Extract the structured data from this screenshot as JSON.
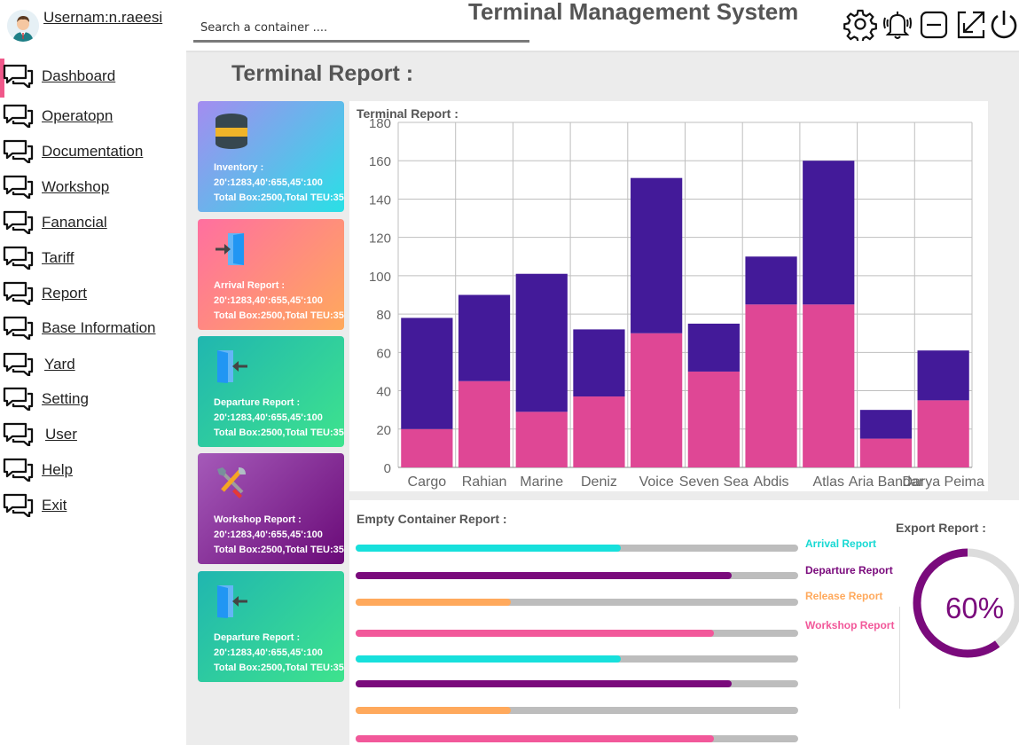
{
  "user": {
    "name": "Usernam:n.raeesi"
  },
  "search": {
    "placeholder": "Search a container ...."
  },
  "app_title": "Terminal Management System",
  "nav": [
    {
      "label": "Dashboard",
      "id": "dashboard"
    },
    {
      "label": "Operatopn",
      "id": "operation"
    },
    {
      "label": "Documentation",
      "id": "documentation"
    },
    {
      "label": "Workshop",
      "id": "workshop"
    },
    {
      "label": "Fanancial",
      "id": "financial"
    },
    {
      "label": "Tariff",
      "id": "tariff"
    },
    {
      "label": "Report",
      "id": "report"
    },
    {
      "label": "Base Information",
      "id": "base-information"
    },
    {
      "label": "Yard",
      "id": "yard"
    },
    {
      "label": "Setting",
      "id": "setting"
    },
    {
      "label": "User",
      "id": "user"
    },
    {
      "label": "Help",
      "id": "help"
    },
    {
      "label": "Exit",
      "id": "exit"
    }
  ],
  "header_icons": [
    "gear-icon",
    "bell-icon",
    "minimize-icon",
    "fullscreen-icon",
    "power-icon"
  ],
  "page_title": "Terminal Report :",
  "cards": [
    {
      "title": "Inventory :",
      "line1": "20':1283,40':655,45':100",
      "line2": "Total Box:2500,Total TEU:35",
      "icon": "database-icon",
      "colors": [
        "#a48cf0",
        "#29e0e6"
      ]
    },
    {
      "title": "Arrival Report :",
      "line1": "20':1283,40':655,45':100",
      "line2": "Total Box:2500,Total TEU:35",
      "icon": "door-enter-icon",
      "colors": [
        "#ff6fa0",
        "#ffa95c"
      ]
    },
    {
      "title": "Departure Report :",
      "line1": "20':1283,40':655,45':100",
      "line2": "Total Box:2500,Total TEU:35",
      "icon": "door-exit-icon",
      "colors": [
        "#20b6b0",
        "#3ee38d"
      ]
    },
    {
      "title": "Workshop Report :",
      "line1": "20':1283,40':655,45':100",
      "line2": "Total Box:2500,Total TEU:35",
      "icon": "tools-icon",
      "colors": [
        "#a55ab9",
        "#6a0a78"
      ]
    },
    {
      "title": "Departure Report :",
      "line1": "20':1283,40':655,45':100",
      "line2": "Total Box:2500,Total TEU:35",
      "icon": "door-exit-icon",
      "colors": [
        "#20b6b0",
        "#3ee38d"
      ]
    }
  ],
  "chart_title": "Terminal Report :",
  "chart_data": {
    "type": "bar",
    "stacked": true,
    "title": "Terminal Report :",
    "categories": [
      "Cargo",
      "Rahian",
      "Marine",
      "Deniz",
      "Voice",
      "Seven Sea",
      "Abdis",
      "Atlas",
      "Aria Bandar",
      "Darya Peima"
    ],
    "series": [
      {
        "values": [
          20,
          45,
          29,
          37,
          70,
          50,
          85,
          85,
          15,
          35
        ],
        "color": "#df4795"
      },
      {
        "values": [
          58,
          45,
          72,
          35,
          81,
          25,
          25,
          75,
          15,
          26
        ],
        "color": "#431a99"
      }
    ],
    "ylim": [
      0,
      180
    ],
    "yticks": [
      0,
      20,
      40,
      60,
      80,
      100,
      120,
      140,
      160,
      180
    ],
    "grid": true
  },
  "empty_title": "Empty Container Report :",
  "progress": [
    {
      "value": 0.6,
      "color": "#17e0dc"
    },
    {
      "value": 0.85,
      "color": "#7a0a7c"
    },
    {
      "value": 0.35,
      "color": "#ffa95c"
    },
    {
      "value": 0.81,
      "color": "#f2589a"
    },
    {
      "value": 0.6,
      "color": "#17e0dc"
    },
    {
      "value": 0.85,
      "color": "#7a0a7c"
    },
    {
      "value": 0.35,
      "color": "#ffa95c"
    },
    {
      "value": 0.81,
      "color": "#f2589a"
    }
  ],
  "legend": [
    {
      "label": "Arrival Report",
      "color": "#17d9d3"
    },
    {
      "label": "Departure Report",
      "color": "#7a0a7c"
    },
    {
      "label": "Release Report",
      "color": "#ffa95c"
    },
    {
      "label": "Workshop Report",
      "color": "#f2589a"
    }
  ],
  "export_title": "Export Report :",
  "export_value": "60%",
  "export_fraction": 0.6
}
